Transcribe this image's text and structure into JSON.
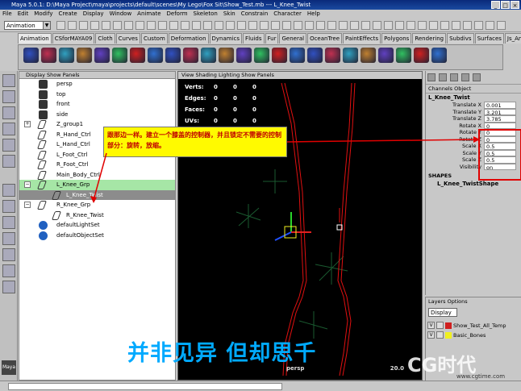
{
  "window": {
    "title": "Maya 5.0.1: D:\\Maya Project\\maya\\projects\\default\\scenes\\My Lego\\Fox Sit\\Show_Test.mb  ---  L_Knee_Twist"
  },
  "menu": [
    "File",
    "Edit",
    "Modify",
    "Create",
    "Display",
    "Window",
    "Animate",
    "Deform",
    "Skeleton",
    "Skin",
    "Constrain",
    "Character",
    "Help"
  ],
  "mode_select": "Animation",
  "shelf_tabs": [
    "Animation",
    "CSforMAYA09",
    "Cloth",
    "Curves",
    "Custom",
    "Deformation",
    "Dynamics",
    "Fluids",
    "Fur",
    "General",
    "OceanTree",
    "PaintEffects",
    "Polygons",
    "Rendering",
    "Subdivs",
    "Surfaces",
    "Js_Animation"
  ],
  "outliner": {
    "menu": "Display  Show  Panels",
    "items": [
      "persp",
      "top",
      "front",
      "side",
      "Z_group1",
      "R_Hand_Ctrl",
      "L_Hand_Ctrl",
      "L_Foot_Ctrl",
      "R_Foot_Ctrl",
      "Main_Body_Ctrl",
      "L_Knee_Grp",
      "L_Knee_Twist",
      "R_Knee_Grp",
      "R_Knee_Twist",
      "defaultLightSet",
      "defaultObjectSet"
    ]
  },
  "viewport": {
    "menu": "View  Shading  Lighting  Show  Panels",
    "stats": [
      [
        "Verts:",
        "0",
        "0",
        "0"
      ],
      [
        "Edges:",
        "0",
        "0",
        "0"
      ],
      [
        "Faces:",
        "0",
        "0",
        "0"
      ],
      [
        "UVs:",
        "0",
        "0",
        "0"
      ]
    ],
    "camera": "persp",
    "frame": "20.0"
  },
  "annotation": "跟那边一样。建立一个膝盖的控制器，并且锁定不需要的控制部分：旋转，放缩。",
  "channel_box": {
    "tabs": "Channels  Object",
    "object": "L_Knee_Twist",
    "channels": [
      [
        "Translate X",
        "0.001"
      ],
      [
        "Translate Y",
        "3.201"
      ],
      [
        "Translate Z",
        "3.785"
      ],
      [
        "Rotate X",
        "0"
      ],
      [
        "Rotate Y",
        "0"
      ],
      [
        "Rotate Z",
        "0"
      ],
      [
        "Scale X",
        "0.5"
      ],
      [
        "Scale Y",
        "0.5"
      ],
      [
        "Scale Z",
        "0.5"
      ],
      [
        "Visibility",
        "on"
      ]
    ],
    "shapes_label": "SHAPES",
    "shape_name": "L_Knee_TwistShape"
  },
  "layers": {
    "menu": "Layers  Options",
    "select": "Display",
    "rows": [
      {
        "v": "V",
        "name": "Show_Test_All_Temp",
        "color": "#d02020"
      },
      {
        "v": "V",
        "name": "Basic_Bones",
        "color": "#f0f020"
      }
    ]
  },
  "subtitle": "并非见异 但却思千",
  "watermark": "CG时代",
  "watermark_url": "www.cgtime.com",
  "logo": "Maya"
}
